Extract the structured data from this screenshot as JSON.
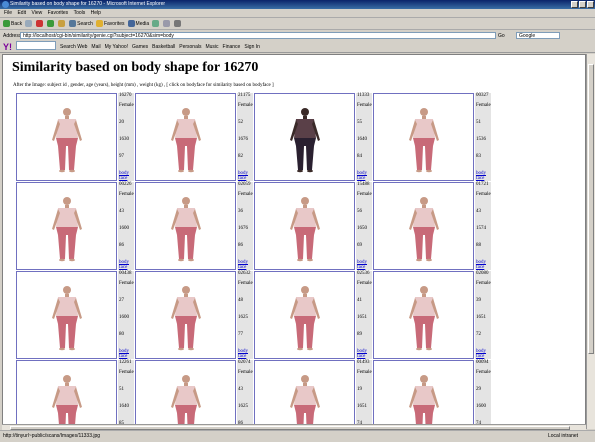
{
  "window": {
    "title": "Similarity based on body shape for 16270 - Microsoft Internet Explorer"
  },
  "menu": [
    "File",
    "Edit",
    "View",
    "Favorites",
    "Tools",
    "Help"
  ],
  "toolbar": {
    "back": "Back",
    "search": "Search",
    "favorites": "Favorites",
    "media": "Media"
  },
  "address": {
    "label": "Address",
    "url": "http://localhost/cgi-bin/similarity/genie.cgi?subject=16270&sim=body",
    "go": "Go",
    "google": "Google"
  },
  "yahoo": {
    "brand": "Y!",
    "search_web": "Search Web",
    "links": [
      "Mail",
      "My Yahoo!",
      "Games",
      "Basketball",
      "Personals",
      "Music",
      "Finance",
      "Sign In"
    ]
  },
  "page": {
    "title": "Similarity based on body shape for 16270",
    "caption": "After the Image: subject id , gender, age (years), height (mm) , weight (kg) , [ click on bodyface for similarity based on bodyface ]"
  },
  "labels": {
    "body": "body",
    "face": "face"
  },
  "rows": [
    [
      {
        "id": "16270",
        "gender": "Female",
        "age": "20",
        "height": "1630",
        "weight": "97"
      },
      {
        "id": "21175",
        "gender": "Female",
        "age": "52",
        "height": "1676",
        "weight": "82"
      },
      {
        "id": "11333",
        "gender": "Female",
        "age": "55",
        "height": "1640",
        "weight": "84"
      },
      {
        "id": "00327",
        "gender": "Female",
        "age": "51",
        "height": "1536",
        "weight": "83"
      }
    ],
    [
      {
        "id": "00226",
        "gender": "Female",
        "age": "43",
        "height": "1600",
        "weight": "86"
      },
      {
        "id": "02059",
        "gender": "Female",
        "age": "36",
        "height": "1676",
        "weight": "86"
      },
      {
        "id": "15488",
        "gender": "Female",
        "age": "56",
        "height": "1650",
        "weight": "69"
      },
      {
        "id": "01721",
        "gender": "Female",
        "age": "43",
        "height": "1574",
        "weight": "88"
      }
    ],
    [
      {
        "id": "00438",
        "gender": "Female",
        "age": "27",
        "height": "1600",
        "weight": "80"
      },
      {
        "id": "02632",
        "gender": "Female",
        "age": "48",
        "height": "1625",
        "weight": "77"
      },
      {
        "id": "02536",
        "gender": "Female",
        "age": "41",
        "height": "1651",
        "weight": "89"
      },
      {
        "id": "02080",
        "gender": "Female",
        "age": "39",
        "height": "1651",
        "weight": "72"
      }
    ],
    [
      {
        "id": "12261",
        "gender": "Female",
        "age": "51",
        "height": "1640",
        "weight": "85"
      },
      {
        "id": "02074",
        "gender": "Female",
        "age": "43",
        "height": "1625",
        "weight": "86"
      },
      {
        "id": "01493",
        "gender": "Female",
        "age": "19",
        "height": "1651",
        "weight": "74"
      },
      {
        "id": "00094",
        "gender": "Female",
        "age": "29",
        "height": "1600",
        "weight": "74"
      }
    ]
  ],
  "status": {
    "text": "http://tinyurl~public/scans/Images/11333.jpg",
    "zone": "Local intranet"
  }
}
